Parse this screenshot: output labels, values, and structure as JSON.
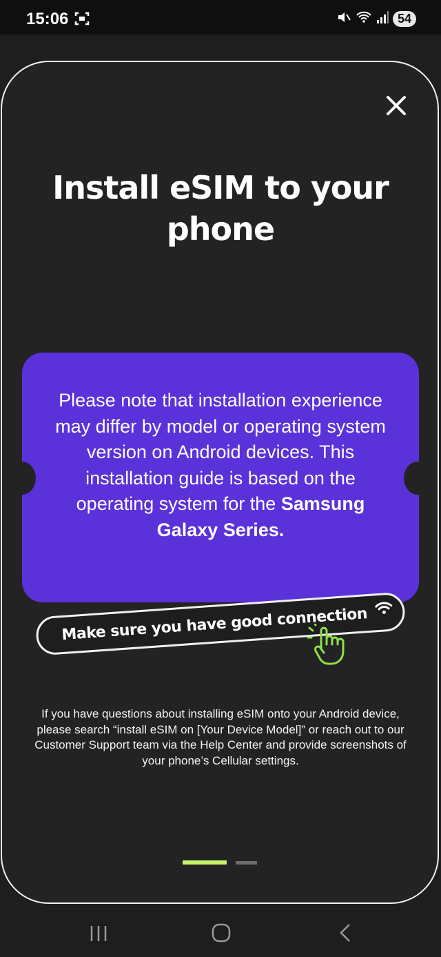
{
  "status_bar": {
    "time": "15:06",
    "battery": "54",
    "icons": [
      "screenshot-icon",
      "mute-icon",
      "wifi-icon",
      "signal-icon"
    ]
  },
  "sheet": {
    "close_icon": "close-icon",
    "title": "Install eSIM to your phone",
    "note": {
      "text": "Please note that installation experience may differ by model or operating system version on Android devices. This installation guide is based on the operating system for the ",
      "bold": "Samsung Galaxy Series."
    },
    "connection_hint": "Make sure you have good connection",
    "help_text": "If you have questions about installing eSIM onto your Android device, please search “install eSIM on [Your Device Model]” or reach out to our Customer Support team via the Help Center and provide screenshots of your phone’s Cellular settings.",
    "pager": {
      "current": 1,
      "total": 2
    }
  },
  "colors": {
    "background": "#1e1e1e",
    "card": "#5b32da",
    "accent": "#c7f36a",
    "text": "#ffffff"
  },
  "nav_bar": [
    "recent-apps-icon",
    "home-icon",
    "back-icon"
  ]
}
